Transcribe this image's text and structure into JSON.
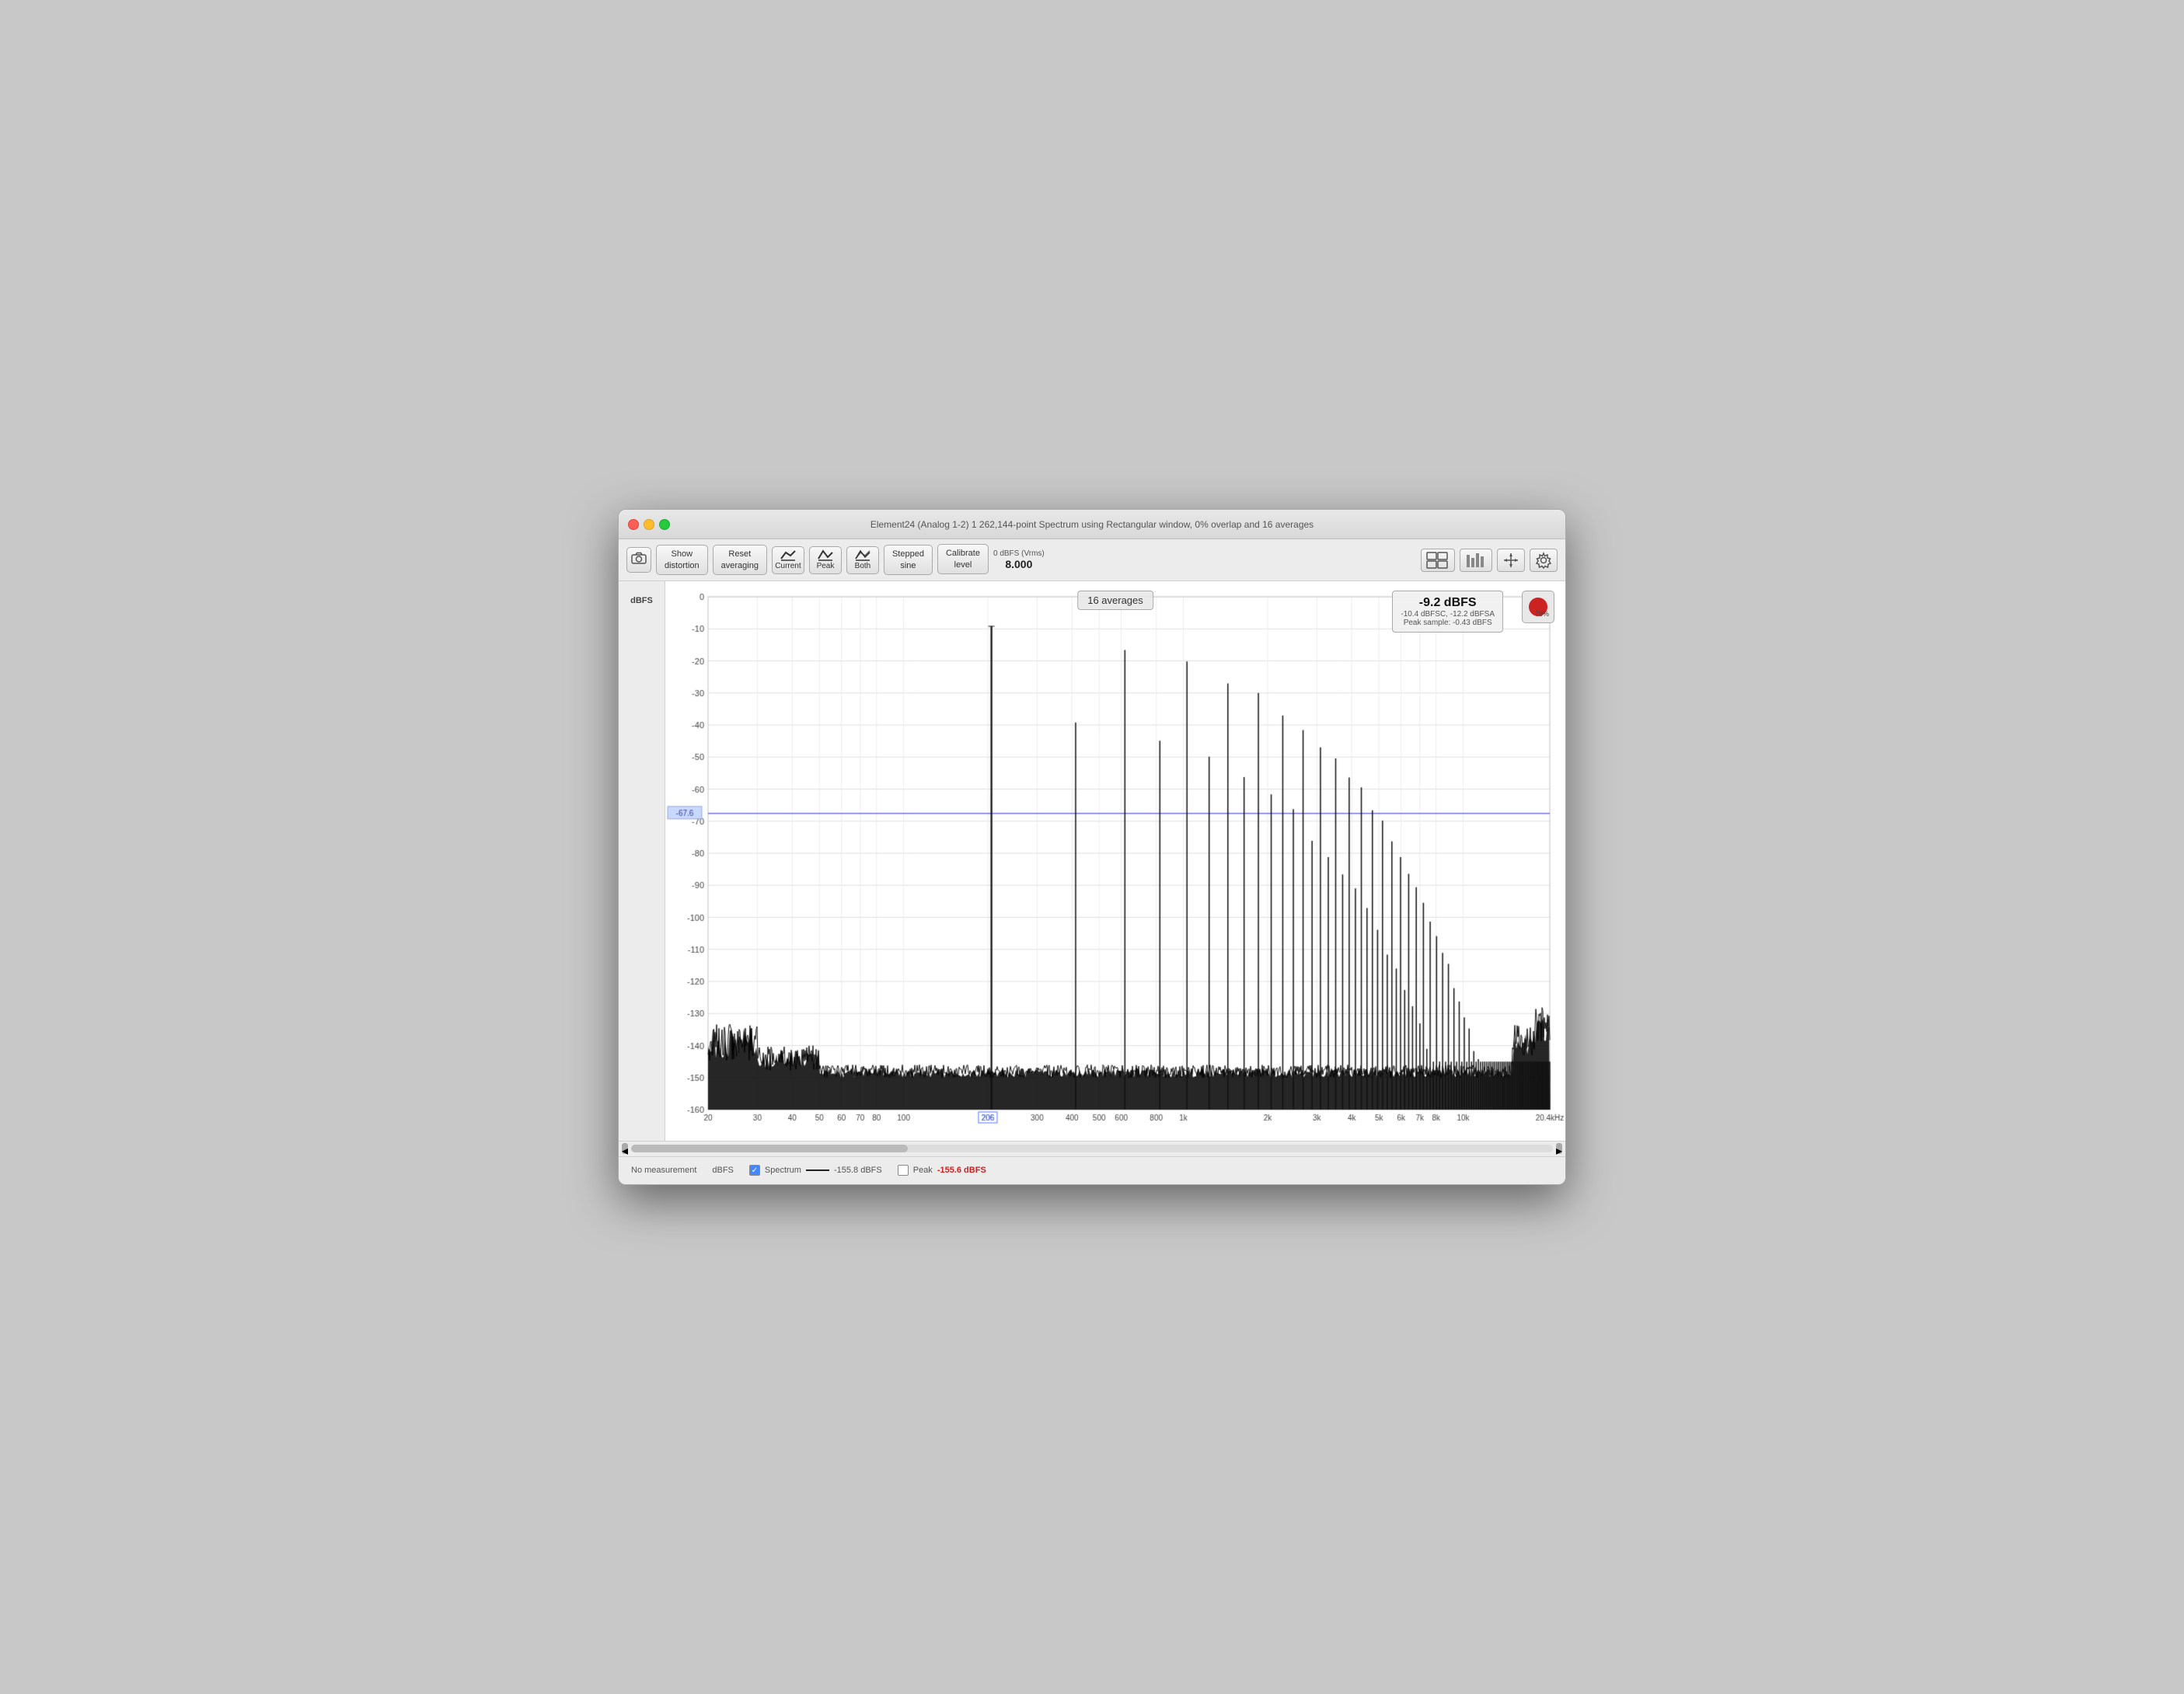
{
  "window": {
    "title": "Element24 (Analog 1-2) 1 262,144-point Spectrum using Rectangular window, 0% overlap and 16 averages"
  },
  "toolbar": {
    "show_distortion": "Show\ndistortion",
    "reset_averaging": "Reset\naveraging",
    "current_label": "Current",
    "peak_label": "Peak",
    "both_label": "Both",
    "stepped_sine_label": "Stepped\nsine",
    "calibrate_label": "Calibrate\nlevel",
    "calibrate_unit": "0 dBFS (Vrms)",
    "calibrate_value": "8.000"
  },
  "chart": {
    "averages": "16 averages",
    "peak_main": "-9.2 dBFS",
    "peak_sub1": "-10.4 dBFSC, -12.2 dBFSA",
    "peak_sub2": "Peak sample: -0.43 dBFS",
    "level_line": "-67.6",
    "y_labels": [
      "0",
      "-10",
      "-20",
      "-30",
      "-40",
      "-50",
      "-60",
      "-70",
      "-80",
      "-90",
      "-100",
      "-110",
      "-120",
      "-130",
      "-140",
      "-150",
      "-160"
    ],
    "x_labels": [
      "20",
      "30",
      "40",
      "50",
      "60",
      "70",
      "80",
      "100",
      "206",
      "300",
      "400",
      "500",
      "600",
      "800",
      "1k",
      "2k",
      "3k",
      "4k",
      "5k",
      "6k",
      "7k",
      "8k",
      "10k",
      "20.4kHz"
    ],
    "dbfs_label": "dBFS",
    "record_pct": "78%"
  },
  "status_bar": {
    "no_measurement": "No measurement",
    "dbfs": "dBFS",
    "spectrum_label": "Spectrum",
    "spectrum_value": "-155.8 dBFS",
    "peak_label": "Peak",
    "peak_value": "-155.6 dBFS"
  }
}
